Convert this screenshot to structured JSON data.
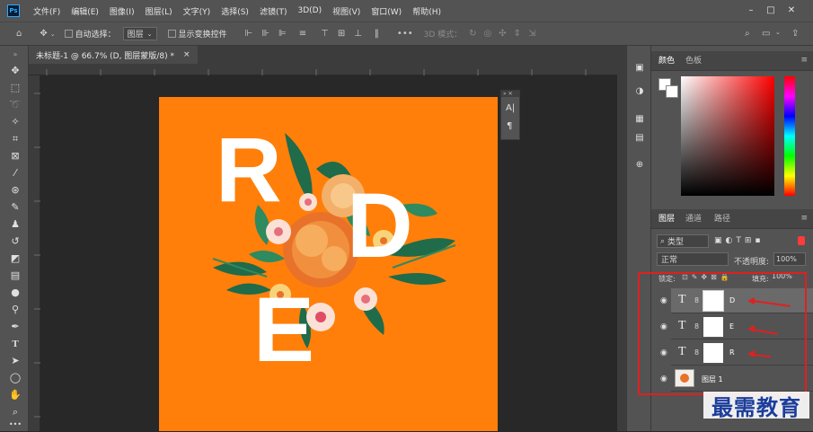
{
  "menubar": {
    "app_icon": "Ps",
    "items": [
      "文件(F)",
      "编辑(E)",
      "图像(I)",
      "图层(L)",
      "文字(Y)",
      "选择(S)",
      "滤镜(T)",
      "3D(D)",
      "视图(V)",
      "窗口(W)",
      "帮助(H)"
    ],
    "window_controls": [
      "minimize-icon",
      "restore-icon",
      "close-icon"
    ]
  },
  "options_bar": {
    "home_icon": "home-icon",
    "move_icon": "move-tool-icon",
    "auto_select_label": "自动选择：",
    "auto_select_value": "图层",
    "show_transform_label": "显示变换控件",
    "mode_3d_label": "3D 模式："
  },
  "document": {
    "tab_title": "未标题-1 @ 66.7% (D, 图层蒙版/8) *",
    "canvas_color": "#ff7f0a",
    "letters": [
      "R",
      "D",
      "E"
    ]
  },
  "right_panel": {
    "color_tabs": [
      "颜色",
      "色板"
    ],
    "layers_tabs": [
      "图层",
      "通道",
      "路径"
    ],
    "filter_kind": "类型",
    "blend_mode": "正常",
    "opacity_label": "不透明度:",
    "opacity_value": "100%",
    "lock_label": "锁定:",
    "fill_label": "填充:",
    "fill_value": "100%",
    "layers": [
      {
        "type": "T",
        "name": "D"
      },
      {
        "type": "T",
        "name": "E"
      },
      {
        "type": "T",
        "name": "R"
      },
      {
        "type": "image",
        "name": "图层 1"
      }
    ]
  },
  "watermark": "最需教育",
  "colors": {
    "accent": "#31a8ff",
    "highlight_box": "#e02020",
    "watermark": "#1c3d9b"
  }
}
